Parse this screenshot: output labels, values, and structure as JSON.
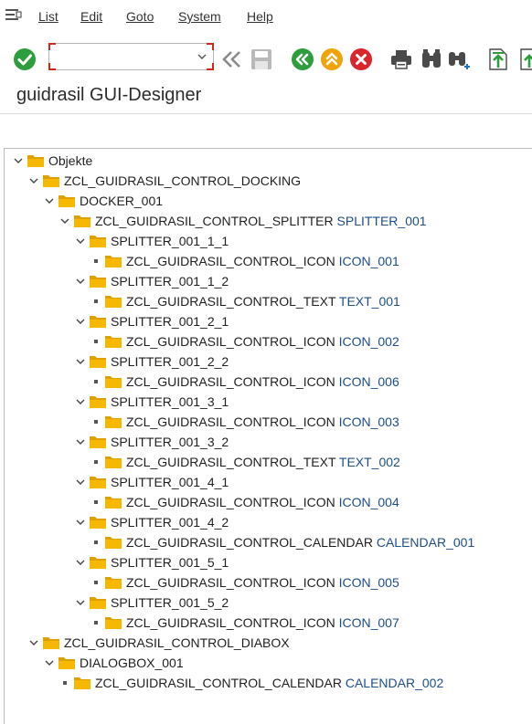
{
  "menu": {
    "items": [
      "List",
      "Edit",
      "Goto",
      "System",
      "Help"
    ]
  },
  "toolbar": {
    "command_value": "",
    "icons": [
      "enter-check-icon",
      "command-field",
      "double-left-icon",
      "save-icon",
      "back-icon",
      "exit-icon",
      "cancel-icon",
      "print-icon",
      "find-icon",
      "find-next-icon",
      "first-page-icon",
      "previous-page-icon"
    ]
  },
  "title": "guidrasil GUI-Designer",
  "colors": {
    "folder": "#f6b800",
    "folder_dark": "#e0a000",
    "green": "#2e9e3d",
    "orange": "#f0a30a",
    "red": "#d9262b",
    "instance_text": "#1d4e89"
  },
  "tree": [
    {
      "level": 0,
      "type": "folder",
      "expanded": true,
      "cls": "Objekte",
      "inst": ""
    },
    {
      "level": 1,
      "type": "folder",
      "expanded": true,
      "cls": "ZCL_GUIDRASIL_CONTROL_DOCKING",
      "inst": ""
    },
    {
      "level": 2,
      "type": "folder",
      "expanded": true,
      "cls": "DOCKER_001",
      "inst": ""
    },
    {
      "level": 3,
      "type": "folder",
      "expanded": true,
      "cls": "ZCL_GUIDRASIL_CONTROL_SPLITTER",
      "inst": "SPLITTER_001"
    },
    {
      "level": 4,
      "type": "folder",
      "expanded": true,
      "cls": "SPLITTER_001_1_1",
      "inst": ""
    },
    {
      "level": 5,
      "type": "leaf",
      "cls": "ZCL_GUIDRASIL_CONTROL_ICON",
      "inst": "ICON_001"
    },
    {
      "level": 4,
      "type": "folder",
      "expanded": true,
      "cls": "SPLITTER_001_1_2",
      "inst": ""
    },
    {
      "level": 5,
      "type": "leaf",
      "cls": "ZCL_GUIDRASIL_CONTROL_TEXT",
      "inst": "TEXT_001"
    },
    {
      "level": 4,
      "type": "folder",
      "expanded": true,
      "cls": "SPLITTER_001_2_1",
      "inst": ""
    },
    {
      "level": 5,
      "type": "leaf",
      "cls": "ZCL_GUIDRASIL_CONTROL_ICON",
      "inst": "ICON_002"
    },
    {
      "level": 4,
      "type": "folder",
      "expanded": true,
      "cls": "SPLITTER_001_2_2",
      "inst": ""
    },
    {
      "level": 5,
      "type": "leaf",
      "cls": "ZCL_GUIDRASIL_CONTROL_ICON",
      "inst": "ICON_006"
    },
    {
      "level": 4,
      "type": "folder",
      "expanded": true,
      "cls": "SPLITTER_001_3_1",
      "inst": ""
    },
    {
      "level": 5,
      "type": "leaf",
      "cls": "ZCL_GUIDRASIL_CONTROL_ICON",
      "inst": "ICON_003"
    },
    {
      "level": 4,
      "type": "folder",
      "expanded": true,
      "cls": "SPLITTER_001_3_2",
      "inst": ""
    },
    {
      "level": 5,
      "type": "leaf",
      "cls": "ZCL_GUIDRASIL_CONTROL_TEXT",
      "inst": "TEXT_002"
    },
    {
      "level": 4,
      "type": "folder",
      "expanded": true,
      "cls": "SPLITTER_001_4_1",
      "inst": ""
    },
    {
      "level": 5,
      "type": "leaf",
      "cls": "ZCL_GUIDRASIL_CONTROL_ICON",
      "inst": "ICON_004"
    },
    {
      "level": 4,
      "type": "folder",
      "expanded": true,
      "cls": "SPLITTER_001_4_2",
      "inst": ""
    },
    {
      "level": 5,
      "type": "leaf",
      "cls": "ZCL_GUIDRASIL_CONTROL_CALENDAR",
      "inst": "CALENDAR_001"
    },
    {
      "level": 4,
      "type": "folder",
      "expanded": true,
      "cls": "SPLITTER_001_5_1",
      "inst": ""
    },
    {
      "level": 5,
      "type": "leaf",
      "cls": "ZCL_GUIDRASIL_CONTROL_ICON",
      "inst": "ICON_005"
    },
    {
      "level": 4,
      "type": "folder",
      "expanded": true,
      "cls": "SPLITTER_001_5_2",
      "inst": ""
    },
    {
      "level": 5,
      "type": "leaf",
      "cls": "ZCL_GUIDRASIL_CONTROL_ICON",
      "inst": "ICON_007"
    },
    {
      "level": 1,
      "type": "folder",
      "expanded": true,
      "cls": "ZCL_GUIDRASIL_CONTROL_DIABOX",
      "inst": ""
    },
    {
      "level": 2,
      "type": "folder",
      "expanded": true,
      "cls": "DIALOGBOX_001",
      "inst": ""
    },
    {
      "level": 3,
      "type": "leaf",
      "cls": "ZCL_GUIDRASIL_CONTROL_CALENDAR",
      "inst": "CALENDAR_002"
    }
  ]
}
